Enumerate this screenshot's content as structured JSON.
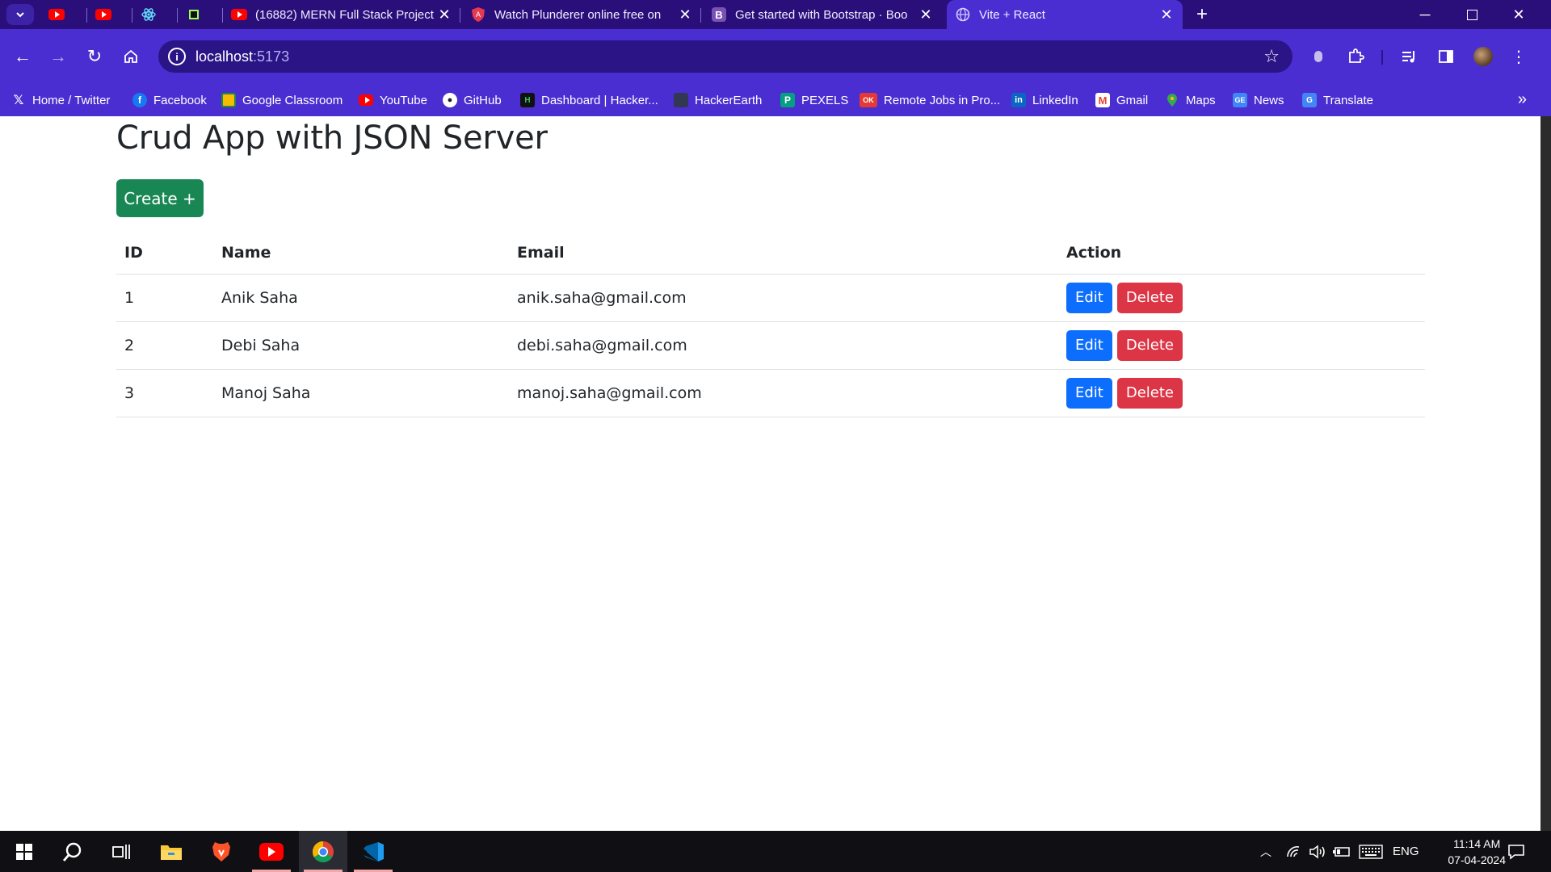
{
  "browser": {
    "tabs": [
      {
        "title": "",
        "icon": "youtube-icon"
      },
      {
        "title": "",
        "icon": "youtube-icon"
      },
      {
        "title": "",
        "icon": "react-icon"
      },
      {
        "title": "",
        "icon": "app-icon"
      },
      {
        "title": "(16882) MERN Full Stack Project",
        "icon": "youtube-icon"
      },
      {
        "title": "Watch Plunderer online free on",
        "icon": "shield-icon"
      },
      {
        "title": "Get started with Bootstrap · Boo",
        "icon": "bootstrap-icon"
      },
      {
        "title": "Vite + React",
        "icon": "globe-icon"
      }
    ],
    "address": {
      "host": "localhost",
      "port": ":5173"
    },
    "bookmarks": [
      {
        "label": "Home / Twitter",
        "icon": "x-icon"
      },
      {
        "label": "Facebook",
        "icon": "facebook-icon"
      },
      {
        "label": "Google Classroom",
        "icon": "classroom-icon"
      },
      {
        "label": "YouTube",
        "icon": "youtube-icon"
      },
      {
        "label": "GitHub",
        "icon": "github-icon"
      },
      {
        "label": "Dashboard | Hacker...",
        "icon": "hackerrank-icon"
      },
      {
        "label": "HackerEarth",
        "icon": "hackerearth-icon"
      },
      {
        "label": "PEXELS",
        "icon": "pexels-icon"
      },
      {
        "label": "Remote Jobs in Pro...",
        "icon": "ok-icon"
      },
      {
        "label": "LinkedIn",
        "icon": "linkedin-icon"
      },
      {
        "label": "Gmail",
        "icon": "gmail-icon"
      },
      {
        "label": "Maps",
        "icon": "maps-icon"
      },
      {
        "label": "News",
        "icon": "news-icon"
      },
      {
        "label": "Translate",
        "icon": "translate-icon"
      }
    ]
  },
  "app": {
    "title": "Crud App with JSON Server",
    "create_label": "Create +",
    "columns": [
      "ID",
      "Name",
      "Email",
      "Action"
    ],
    "rows": [
      {
        "id": "1",
        "name": "Anik Saha",
        "email": "anik.saha@gmail.com"
      },
      {
        "id": "2",
        "name": "Debi Saha",
        "email": "debi.saha@gmail.com"
      },
      {
        "id": "3",
        "name": "Manoj Saha",
        "email": "manoj.saha@gmail.com"
      }
    ],
    "edit_label": "Edit",
    "delete_label": "Delete",
    "colors": {
      "create": "#198754",
      "edit": "#0d6efd",
      "delete": "#dc3545"
    }
  },
  "taskbar": {
    "language": "ENG",
    "time": "11:14 AM",
    "date": "07-04-2024"
  }
}
